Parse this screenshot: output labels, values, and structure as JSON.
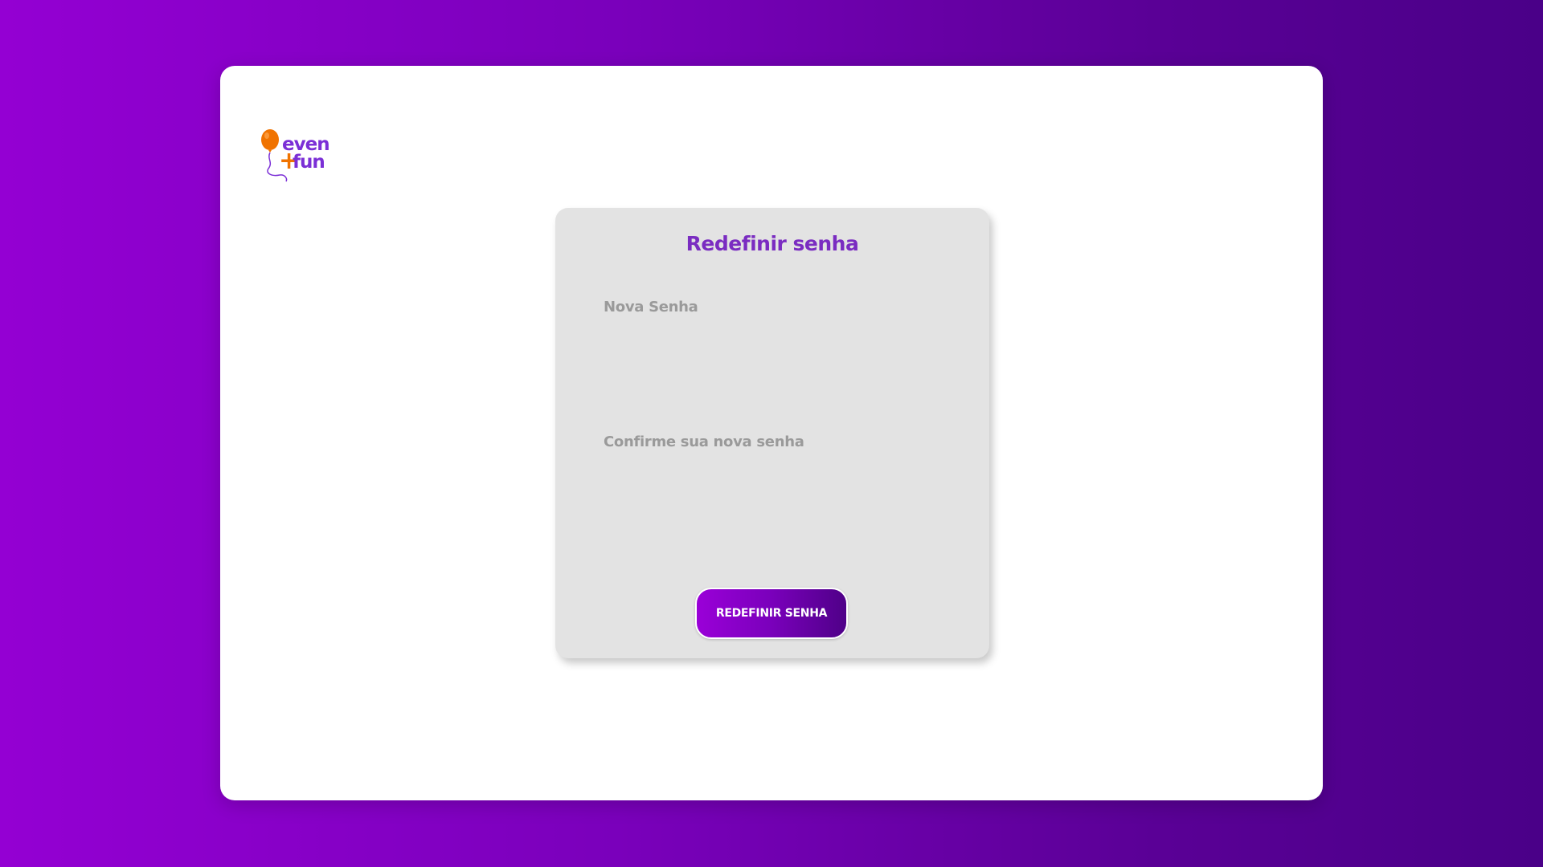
{
  "brand": {
    "logo_line1": "even",
    "logo_plus": "+",
    "logo_line2": "fun",
    "balloon_color": "#f07300",
    "text_color": "#7b2fd6"
  },
  "form": {
    "title": "Redefinir senha",
    "new_password_label": "Nova Senha",
    "new_password_value": "",
    "confirm_password_label": "Confirme sua nova senha",
    "confirm_password_value": "",
    "submit_label": "REDEFINIR SENHA"
  },
  "colors": {
    "background_gradient_start": "#9400d3",
    "background_gradient_end": "#4a0088",
    "card_background": "#e3e3e3",
    "title_color": "#7a2cc1",
    "label_color": "#9a9a9a"
  }
}
